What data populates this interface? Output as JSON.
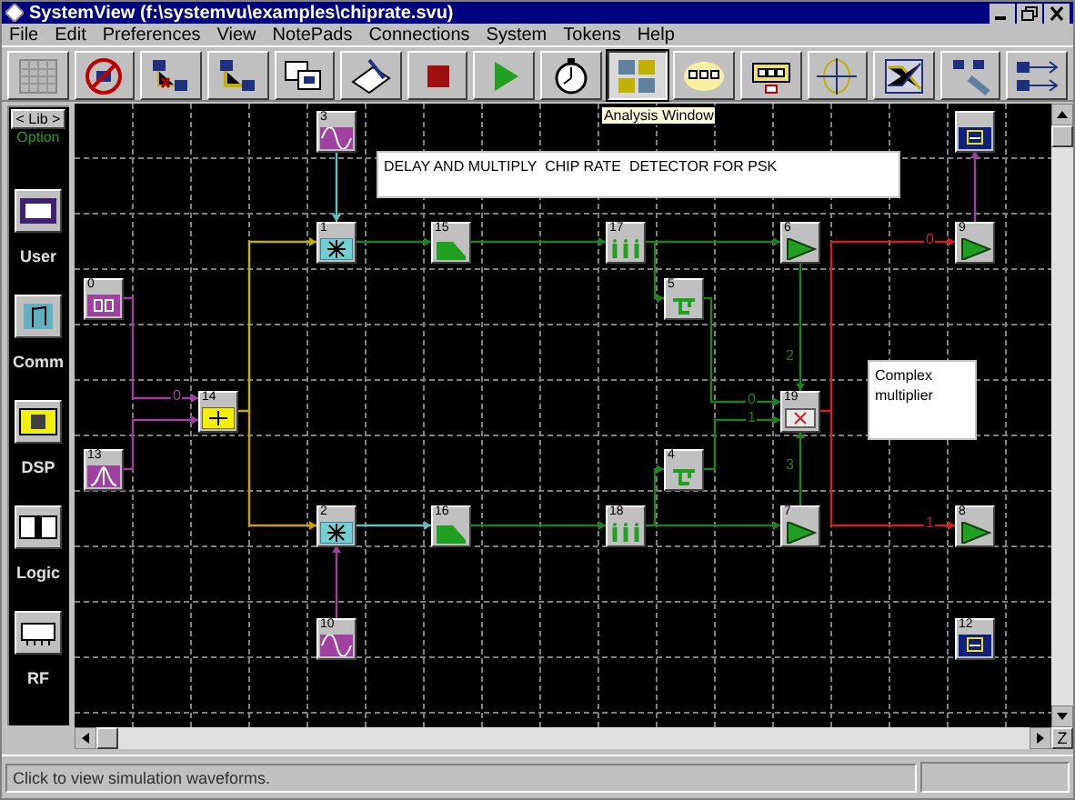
{
  "window": {
    "title": "SystemView (f:\\systemvu\\examples\\chiprate.svu)"
  },
  "menu": [
    "File",
    "Edit",
    "Preferences",
    "View",
    "NotePads",
    "Connections",
    "System",
    "Tokens",
    "Help"
  ],
  "toolbar": [
    {
      "kind": "grid",
      "selected": false
    },
    {
      "kind": "clear",
      "selected": false
    },
    {
      "kind": "disconnect",
      "selected": false
    },
    {
      "kind": "connect",
      "selected": false
    },
    {
      "kind": "duplicate",
      "selected": false
    },
    {
      "kind": "notepad",
      "selected": false
    },
    {
      "kind": "stop",
      "selected": false
    },
    {
      "kind": "run",
      "selected": false
    },
    {
      "kind": "timer",
      "selected": false
    },
    {
      "kind": "analysis",
      "selected": true
    },
    {
      "kind": "metasystem",
      "selected": false
    },
    {
      "kind": "subsystem",
      "selected": false
    },
    {
      "kind": "rootlocus",
      "selected": false
    },
    {
      "kind": "bode",
      "selected": false
    },
    {
      "kind": "probe",
      "selected": false
    },
    {
      "kind": "route",
      "selected": false
    }
  ],
  "tooltip": "Analysis Window",
  "palette": {
    "lib_button": "< Lib >",
    "option": "Option",
    "libraries": [
      {
        "label": "User",
        "kind": "user"
      },
      {
        "label": "Comm",
        "kind": "comm"
      },
      {
        "label": "DSP",
        "kind": "dsp"
      },
      {
        "label": "Logic",
        "kind": "logic"
      },
      {
        "label": "RF",
        "kind": "rf"
      }
    ]
  },
  "notes": [
    "DELAY AND MULTIPLY  CHIP RATE  DETECTOR FOR PSK",
    "Complex multiplier"
  ],
  "blocks": [
    {
      "kind": "scope"
    },
    {
      "number": "3",
      "kind": "sine"
    },
    {
      "number": "1",
      "kind": "mixer"
    },
    {
      "number": "15",
      "kind": "filter"
    },
    {
      "number": "17",
      "kind": "lowpass"
    },
    {
      "number": "6",
      "kind": "gain"
    },
    {
      "number": "9",
      "kind": "gain"
    },
    {
      "number": "0",
      "kind": "source"
    },
    {
      "number": "5",
      "kind": "delay"
    },
    {
      "number": "14",
      "kind": "adder"
    },
    {
      "number": "19",
      "kind": "complex"
    },
    {
      "number": "13",
      "kind": "gauss"
    },
    {
      "number": "4",
      "kind": "delay"
    },
    {
      "number": "2",
      "kind": "mixer"
    },
    {
      "number": "16",
      "kind": "filter"
    },
    {
      "number": "18",
      "kind": "lowpass"
    },
    {
      "number": "7",
      "kind": "gain"
    },
    {
      "number": "8",
      "kind": "gain"
    },
    {
      "number": "10",
      "kind": "sine"
    },
    {
      "number": "12",
      "kind": "scope"
    }
  ],
  "wires": [
    {
      "color": "#a040a0"
    },
    {
      "color": "#60c0c0"
    },
    {
      "color": "#208020"
    },
    {
      "color": "#208020"
    },
    {
      "color": "#208020"
    },
    {
      "color": "#d02020",
      "label": "0"
    },
    {
      "color": "#d02020",
      "label": "1"
    },
    {
      "color": "#208020",
      "label": "2"
    },
    {
      "color": "#208020",
      "label": "3"
    },
    {
      "color": "#208020",
      "label": "0"
    },
    {
      "color": "#208020",
      "label": "1"
    },
    {
      "color": "#208020"
    },
    {
      "color": "#208020"
    },
    {
      "color": "#208020"
    },
    {
      "color": "#208020"
    },
    {
      "color": "#60c0c0"
    },
    {
      "color": "#a040a0"
    },
    {
      "color": "#a040a0",
      "label": "0"
    },
    {
      "color": "#a040a0"
    },
    {
      "color": "#c0b000"
    },
    {
      "color": "#d0a000"
    }
  ],
  "zoom_button": "Z",
  "status_bar": "Click to view simulation waveforms."
}
